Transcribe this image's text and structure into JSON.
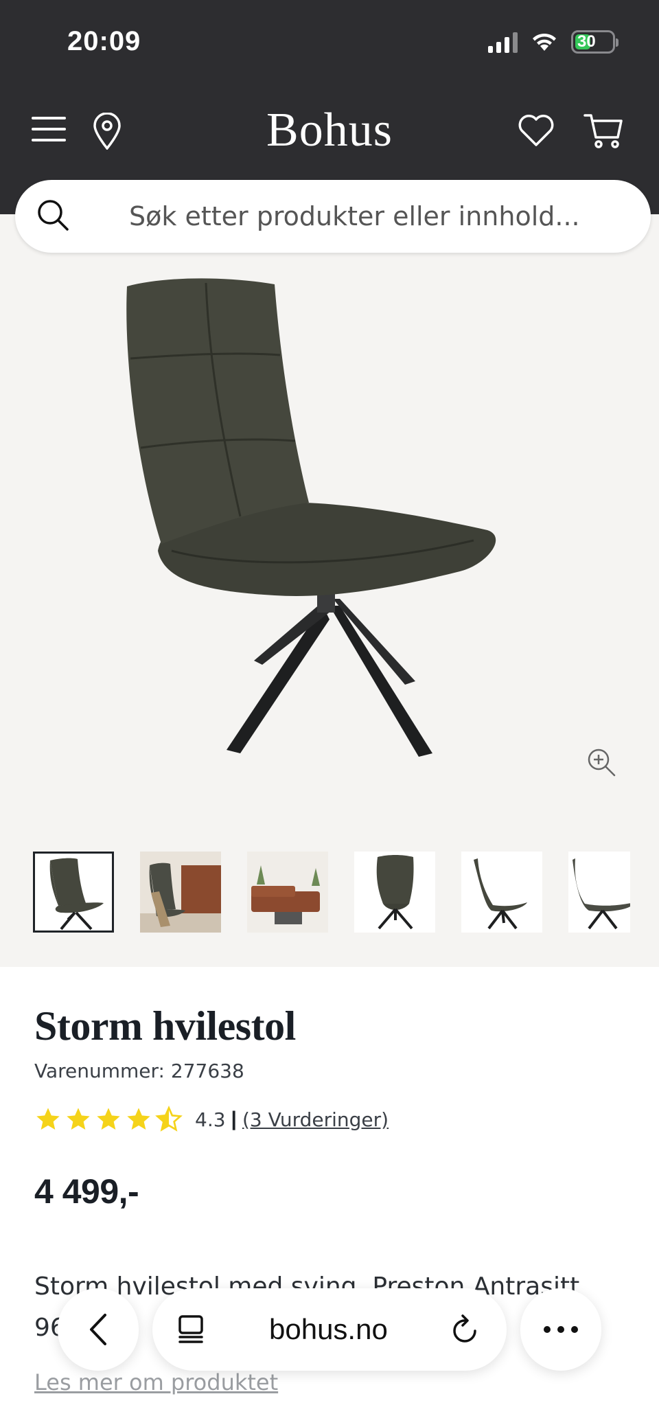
{
  "status_bar": {
    "time": "20:09",
    "battery": "30"
  },
  "header": {
    "logo": "Bohus",
    "menu_icon": "menu-icon",
    "location_icon": "location-pin-icon",
    "wishlist_icon": "heart-icon",
    "cart_icon": "cart-icon"
  },
  "search": {
    "placeholder": "Søk etter produkter eller innhold..."
  },
  "gallery": {
    "thumbnails": [
      "Chair front",
      "Chair in living room with throw",
      "Living room with sofa",
      "Chair front detail",
      "Chair side",
      "Chair angle"
    ],
    "zoom_icon": "zoom-in-icon"
  },
  "product": {
    "title": "Storm hvilestol",
    "sku": "Varenummer: 277638",
    "rating_value": "4.3",
    "rating_separator": "|",
    "rating_stars": 4.3,
    "reviews": "(3 Vurderinger)",
    "price": "4 499,-",
    "description": "Storm hvilestol med sving, Preston Antrasitt 96 22c",
    "read_more": "Les mer om produktet"
  },
  "browser_bar": {
    "url": "bohus.no"
  },
  "colors": {
    "header_bg": "#2d2d30",
    "gallery_bg": "#f5f4f2",
    "star": "#f5d31a"
  }
}
